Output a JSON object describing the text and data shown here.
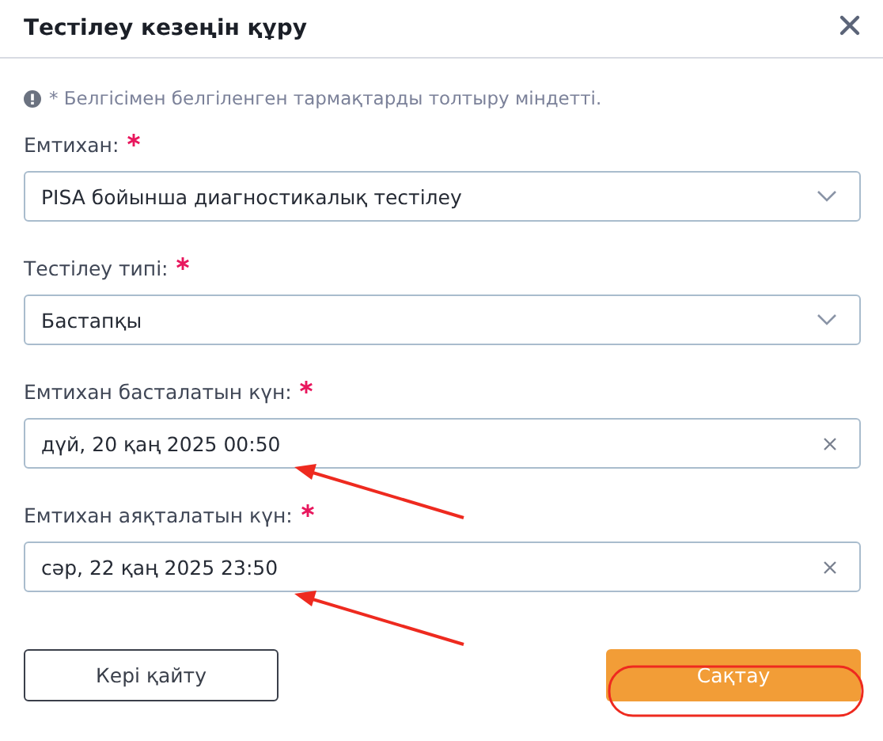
{
  "dialog": {
    "title": "Тестілеу кезеңін құру",
    "note": "* Белгісімен белгіленген тармақтарды толтыру міндетті."
  },
  "fields": [
    {
      "kind": "select",
      "label": "Емтихан:",
      "required": true,
      "value": "PISA бойынша диагностикалық тестілеу"
    },
    {
      "kind": "select",
      "label": "Тестілеу типі:",
      "required": true,
      "value": "Бастапқы"
    },
    {
      "kind": "date",
      "label": "Емтихан басталатын күн:",
      "required": true,
      "value": "дүй, 20 қаң 2025 00:50"
    },
    {
      "kind": "date",
      "label": "Емтихан аяқталатын күн:",
      "required": true,
      "value": "сәр, 22 қаң 2025 23:50"
    }
  ],
  "buttons": [
    {
      "kind": "secondary",
      "label": "Кері қайту"
    },
    {
      "kind": "primary",
      "label": "Сақтау"
    }
  ]
}
